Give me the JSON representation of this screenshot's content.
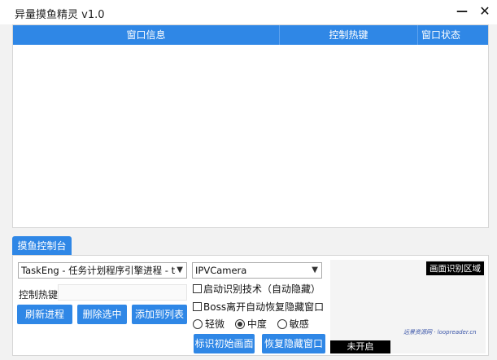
{
  "window": {
    "title": "异量摸鱼精灵 v1.0",
    "minimize_icon": "minimize-icon",
    "close_icon": "close-icon"
  },
  "list": {
    "columns": [
      "窗口信息",
      "控制热键",
      "窗口状态"
    ]
  },
  "control": {
    "tab_label": "摸鱼控制台",
    "process_select": "TaskEng - 任务计划程序引擎进程 - taskeng",
    "camera_select": "IPVCamera",
    "hotkey_label": "控制热键",
    "hotkey_value": "",
    "buttons": {
      "refresh": "刷新进程",
      "delete": "删除选中",
      "add": "添加到列表",
      "mark_initial": "标识初始画面",
      "restore_hidden": "恢复隐藏窗口"
    },
    "checks": {
      "auto_detect": "启动识别技术（自动隐藏）",
      "boss_leave": "Boss离开自动恢复隐藏窗口"
    },
    "sensitivity": {
      "options": [
        "轻微",
        "中度",
        "敏感"
      ],
      "selected": "中度"
    },
    "preview": {
      "area_label": "画面识别区域",
      "status": "未开启",
      "watermark": "远景资源网 · loopreader.cn"
    }
  }
}
